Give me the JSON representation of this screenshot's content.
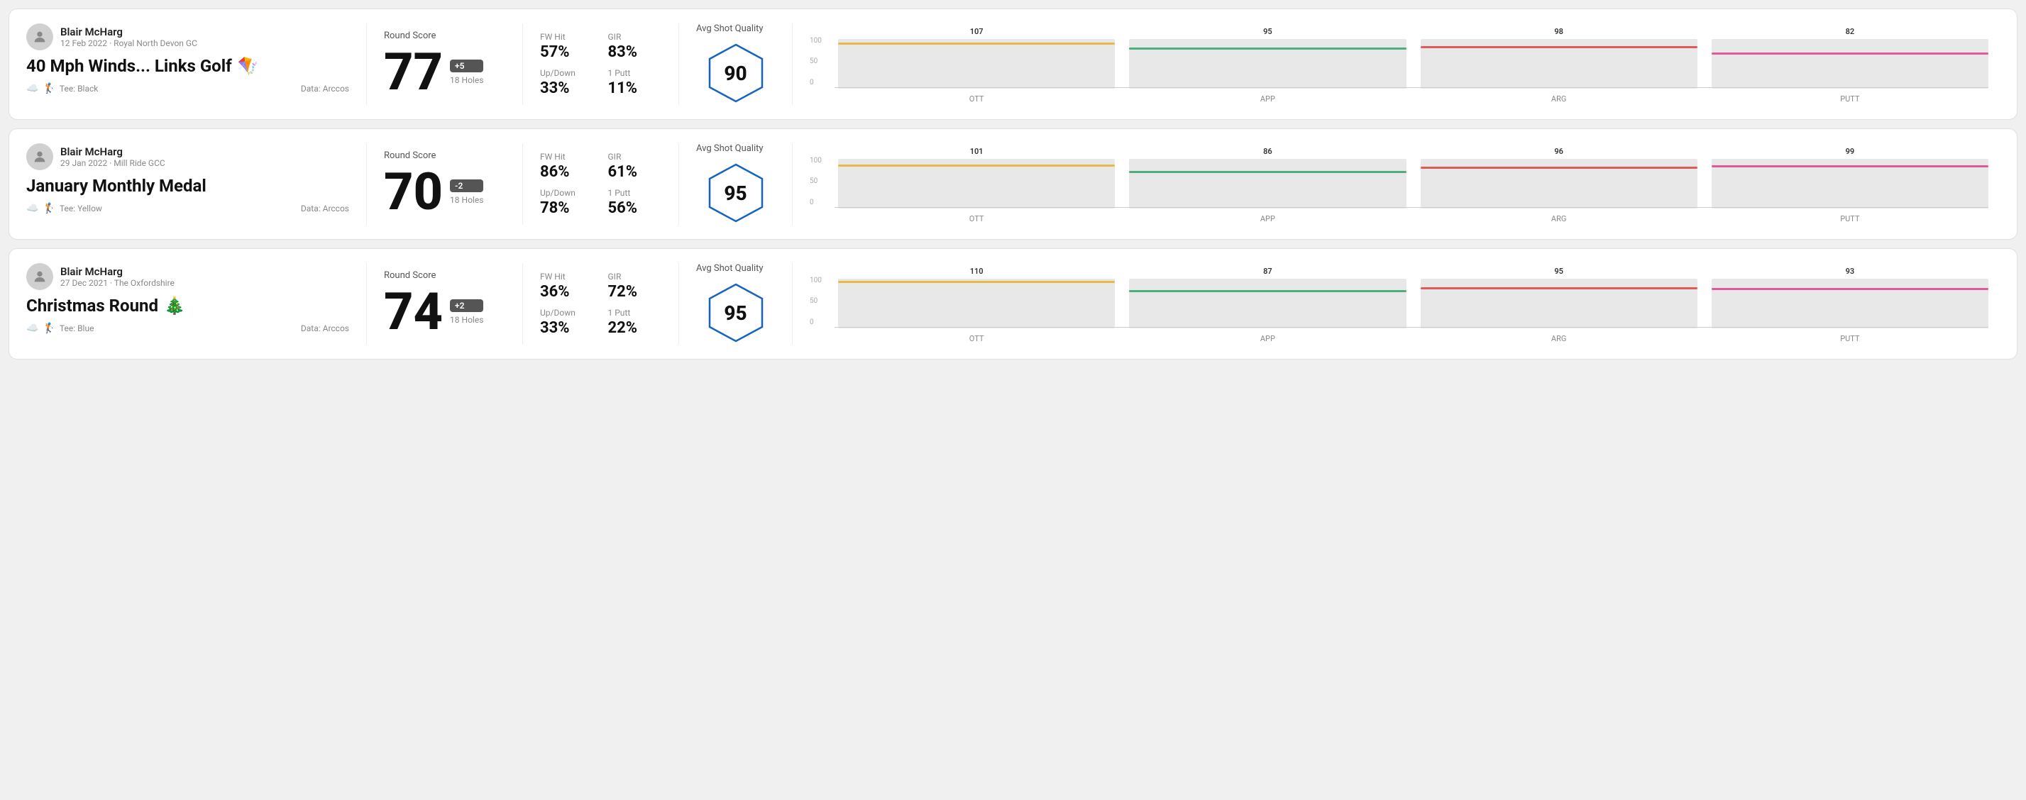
{
  "cards": [
    {
      "id": "card-1",
      "user": {
        "name": "Blair McHarg",
        "meta": "12 Feb 2022 · Royal North Devon GC"
      },
      "title": "40 Mph Winds... Links Golf",
      "title_emoji": "🪁",
      "tee": "Black",
      "data_source": "Data: Arccos",
      "round_score_label": "Round Score",
      "score": "77",
      "score_diff": "+5",
      "holes": "18 Holes",
      "fw_hit_label": "FW Hit",
      "fw_hit_value": "57%",
      "gir_label": "GIR",
      "gir_value": "83%",
      "up_down_label": "Up/Down",
      "up_down_value": "33%",
      "one_putt_label": "1 Putt",
      "one_putt_value": "11%",
      "quality_label": "Avg Shot Quality",
      "quality_score": "90",
      "chart": {
        "columns": [
          {
            "label": "OTT",
            "value": 107,
            "color": "#e8b84b",
            "height_pct": 72
          },
          {
            "label": "APP",
            "value": 95,
            "color": "#4caf7d",
            "height_pct": 63
          },
          {
            "label": "ARG",
            "value": 98,
            "color": "#e05a5a",
            "height_pct": 65
          },
          {
            "label": "PUTT",
            "value": 82,
            "color": "#e05a9a",
            "height_pct": 55
          }
        ]
      }
    },
    {
      "id": "card-2",
      "user": {
        "name": "Blair McHarg",
        "meta": "29 Jan 2022 · Mill Ride GCC"
      },
      "title": "January Monthly Medal",
      "title_emoji": "",
      "tee": "Yellow",
      "data_source": "Data: Arccos",
      "round_score_label": "Round Score",
      "score": "70",
      "score_diff": "-2",
      "holes": "18 Holes",
      "fw_hit_label": "FW Hit",
      "fw_hit_value": "86%",
      "gir_label": "GIR",
      "gir_value": "61%",
      "up_down_label": "Up/Down",
      "up_down_value": "78%",
      "one_putt_label": "1 Putt",
      "one_putt_value": "56%",
      "quality_label": "Avg Shot Quality",
      "quality_score": "95",
      "chart": {
        "columns": [
          {
            "label": "OTT",
            "value": 101,
            "color": "#e8b84b",
            "height_pct": 67
          },
          {
            "label": "APP",
            "value": 86,
            "color": "#4caf7d",
            "height_pct": 57
          },
          {
            "label": "ARG",
            "value": 96,
            "color": "#e05a5a",
            "height_pct": 64
          },
          {
            "label": "PUTT",
            "value": 99,
            "color": "#e05a9a",
            "height_pct": 66
          }
        ]
      }
    },
    {
      "id": "card-3",
      "user": {
        "name": "Blair McHarg",
        "meta": "27 Dec 2021 · The Oxfordshire"
      },
      "title": "Christmas Round",
      "title_emoji": "🎄",
      "tee": "Blue",
      "data_source": "Data: Arccos",
      "round_score_label": "Round Score",
      "score": "74",
      "score_diff": "+2",
      "holes": "18 Holes",
      "fw_hit_label": "FW Hit",
      "fw_hit_value": "36%",
      "gir_label": "GIR",
      "gir_value": "72%",
      "up_down_label": "Up/Down",
      "up_down_value": "33%",
      "one_putt_label": "1 Putt",
      "one_putt_value": "22%",
      "quality_label": "Avg Shot Quality",
      "quality_score": "95",
      "chart": {
        "columns": [
          {
            "label": "OTT",
            "value": 110,
            "color": "#e8b84b",
            "height_pct": 73
          },
          {
            "label": "APP",
            "value": 87,
            "color": "#4caf7d",
            "height_pct": 58
          },
          {
            "label": "ARG",
            "value": 95,
            "color": "#e05a5a",
            "height_pct": 63
          },
          {
            "label": "PUTT",
            "value": 93,
            "color": "#e05a9a",
            "height_pct": 62
          }
        ]
      }
    }
  ],
  "y_axis": {
    "top": "100",
    "mid": "50",
    "bottom": "0"
  }
}
